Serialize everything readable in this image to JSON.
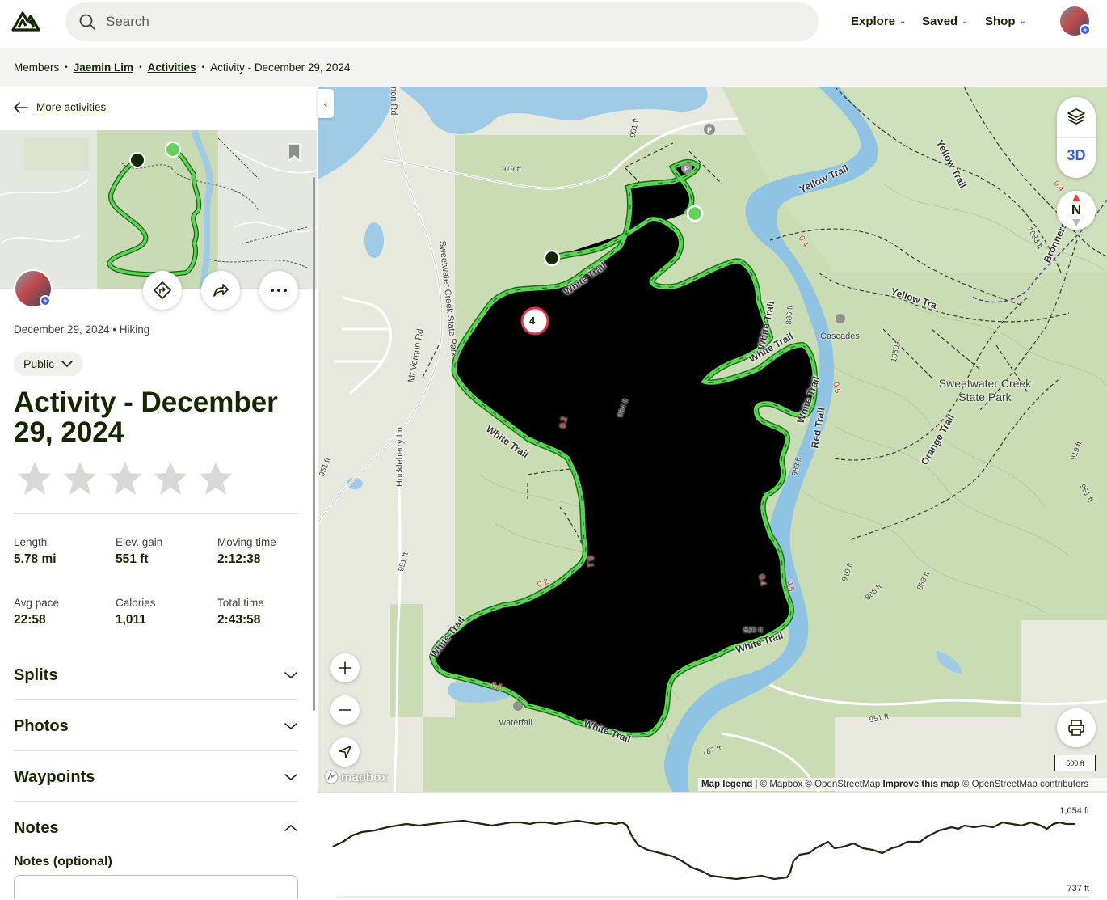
{
  "header": {
    "search_placeholder": "Search",
    "nav": [
      "Explore",
      "Saved",
      "Shop"
    ],
    "badge_symbol": "+"
  },
  "breadcrumb": {
    "items": [
      "Members",
      "Jaemin Lim",
      "Activities",
      "Activity - December 29, 2024"
    ]
  },
  "panel": {
    "back_label": "More activities",
    "meta": "December 29, 2024 • Hiking",
    "visibility": "Public",
    "title": "Activity - December 29, 2024",
    "rating": 0,
    "rating_max": 5,
    "stats": [
      {
        "label": "Length",
        "value": "5.78 mi"
      },
      {
        "label": "Elev. gain",
        "value": "551 ft"
      },
      {
        "label": "Moving time",
        "value": "2:12:38"
      },
      {
        "label": "Avg pace",
        "value": "22:58"
      },
      {
        "label": "Calories",
        "value": "1,011"
      },
      {
        "label": "Total time",
        "value": "2:43:58"
      }
    ],
    "sections": [
      "Splits",
      "Photos",
      "Waypoints",
      "Notes"
    ],
    "notes_label": "Notes (optional)"
  },
  "map": {
    "park_name": "Sweetwater Creek State Park",
    "button_3d": "3D",
    "compass_label": "N",
    "scale_label": "500 ft",
    "mapbox_logo": "mapbox",
    "waypoint_number": "4",
    "attribution": {
      "legend": "Map legend",
      "mapbox": "| © Mapbox © OpenStreetMap",
      "improve": "Improve this map",
      "osm": "© OpenStreetMap contributors"
    },
    "poi_labels": [
      "Cascades",
      "waterfall"
    ],
    "road_labels": [
      "Sweetwater Creek State Park",
      "Mt Vernon Rd",
      "Huckleberry Ln",
      "non Rd"
    ],
    "trail_labels": [
      "White Trail",
      "Yellow Trail",
      "Red Trail",
      "Orange Trail",
      "Bronners",
      "Yellow Tra"
    ],
    "elevation_labels": [
      "919 ft",
      "951 ft",
      "886 ft",
      "984 ft",
      "1050 ft",
      "1083 ft",
      "820 ft",
      "787 ft",
      "853 ft",
      "951 ft",
      "919 ft",
      "886 ft",
      "951 ft",
      "919 ft",
      "951 ft",
      "983 ft",
      "951 ft"
    ],
    "distance_labels": [
      "0.1",
      "0.2",
      "0.2",
      "0.5",
      "0.4",
      "0.5",
      "0.4",
      "0.4",
      "0.5"
    ]
  },
  "elevation": {
    "max_label": "1,054 ft",
    "min_label": "737 ft"
  },
  "colors": {
    "brand": "#142800",
    "route": "#5bd653",
    "route_outline": "#1e6d1e",
    "water": "#9fcbe6",
    "park": "#c8dcb1",
    "start_marker": "#64d15c",
    "end_marker": "#142800"
  }
}
